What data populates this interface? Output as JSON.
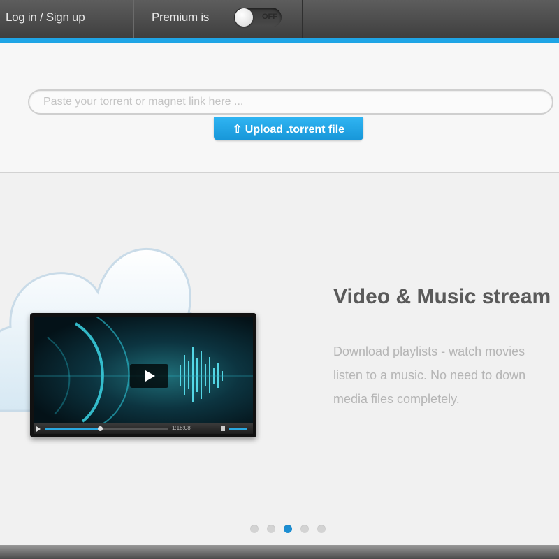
{
  "header": {
    "login_label": "Log in / Sign up",
    "premium_label": "Premium is",
    "premium_toggle_state": "OFF"
  },
  "upload": {
    "placeholder": "Paste your torrent or magnet link here ...",
    "upload_button_label": "⇧ Upload .torrent file"
  },
  "feature": {
    "title": "Video & Music stream",
    "description_lines": [
      "Download playlists - watch movies",
      "listen to a music. No need to down",
      "media files completely."
    ],
    "video_time": "1:18:08"
  },
  "slider": {
    "slide_count": 5,
    "active_index": 2
  },
  "colors": {
    "accent": "#1fa5e6",
    "button": "#1796d8",
    "active_dot": "#1c8ed2"
  }
}
